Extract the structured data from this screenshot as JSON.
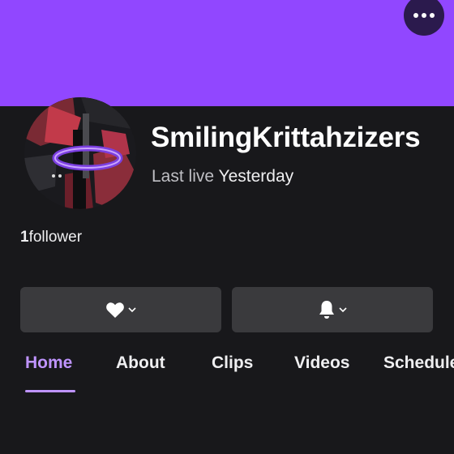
{
  "channel": {
    "name": "SmilingKrittahzizers",
    "last_live_label": "Last live",
    "last_live_value": "Yesterday",
    "follower_count": "1",
    "follower_label": "follower"
  },
  "header": {
    "more_icon": "more-horizontal-icon"
  },
  "actions": {
    "follow_icon": "heart-icon",
    "notify_icon": "bell-icon"
  },
  "tabs": [
    {
      "label": "Home",
      "active": true
    },
    {
      "label": "About",
      "active": false
    },
    {
      "label": "Clips",
      "active": false
    },
    {
      "label": "Videos",
      "active": false
    },
    {
      "label": "Schedule",
      "active": false
    }
  ],
  "colors": {
    "banner": "#9147ff",
    "background": "#18181b",
    "accent": "#bf94ff",
    "button": "#3a3a3d"
  }
}
